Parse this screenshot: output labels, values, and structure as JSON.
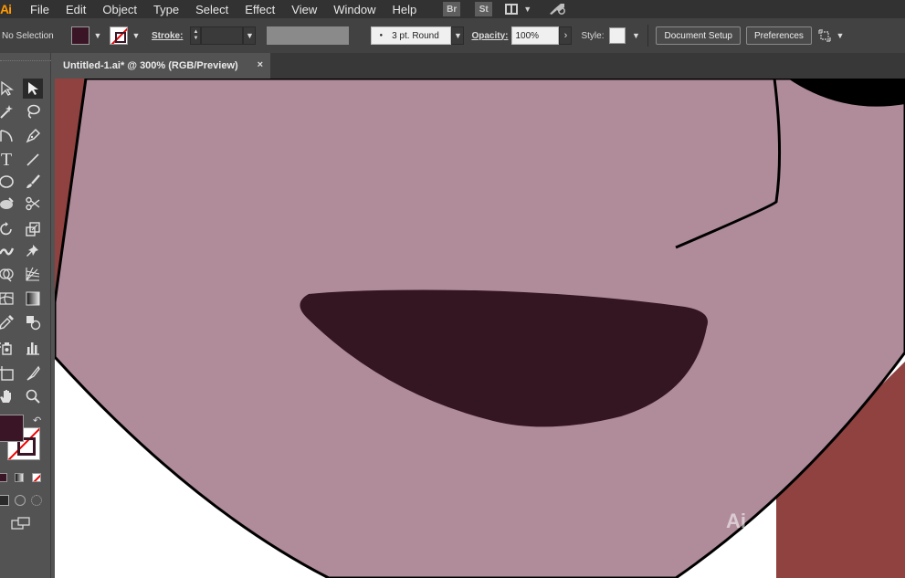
{
  "app": {
    "logo_text": "Ai"
  },
  "menubar": {
    "items": [
      "File",
      "Edit",
      "Object",
      "Type",
      "Select",
      "Effect",
      "View",
      "Window",
      "Help"
    ],
    "bridge_label": "Br",
    "stock_label": "St"
  },
  "controlbar": {
    "selection_status": "No Selection",
    "stroke_label": "Stroke:",
    "brush_value": "3 pt. Round",
    "opacity_label": "Opacity:",
    "opacity_value": "100%",
    "style_label": "Style:",
    "document_setup_label": "Document Setup",
    "preferences_label": "Preferences"
  },
  "document": {
    "tab_title": "Untitled-1.ai* @ 300% (RGB/Preview)",
    "close_glyph": "×"
  },
  "colors": {
    "fill": "#3a1526",
    "skin": "#b08c9a",
    "background_red": "#8f4240",
    "mouth": "#341522",
    "ui_dark": "#323232",
    "ui_panel": "#535353",
    "accent_logo": "#ff9a00"
  },
  "tools": [
    "selection-tool",
    "direct-selection-tool",
    "magic-wand-tool",
    "lasso-tool",
    "pen-tool",
    "curvature-tool",
    "type-tool",
    "line-segment-tool",
    "ellipse-tool",
    "paintbrush-tool",
    "shaper-tool",
    "scissors-tool",
    "rotate-tool",
    "scale-tool",
    "width-tool",
    "free-transform-tool",
    "shape-builder-tool",
    "perspective-grid-tool",
    "mesh-tool",
    "gradient-tool",
    "eyedropper-tool",
    "blend-tool",
    "symbol-sprayer-tool",
    "column-graph-tool",
    "artboard-tool",
    "slice-tool",
    "hand-tool",
    "zoom-tool"
  ]
}
